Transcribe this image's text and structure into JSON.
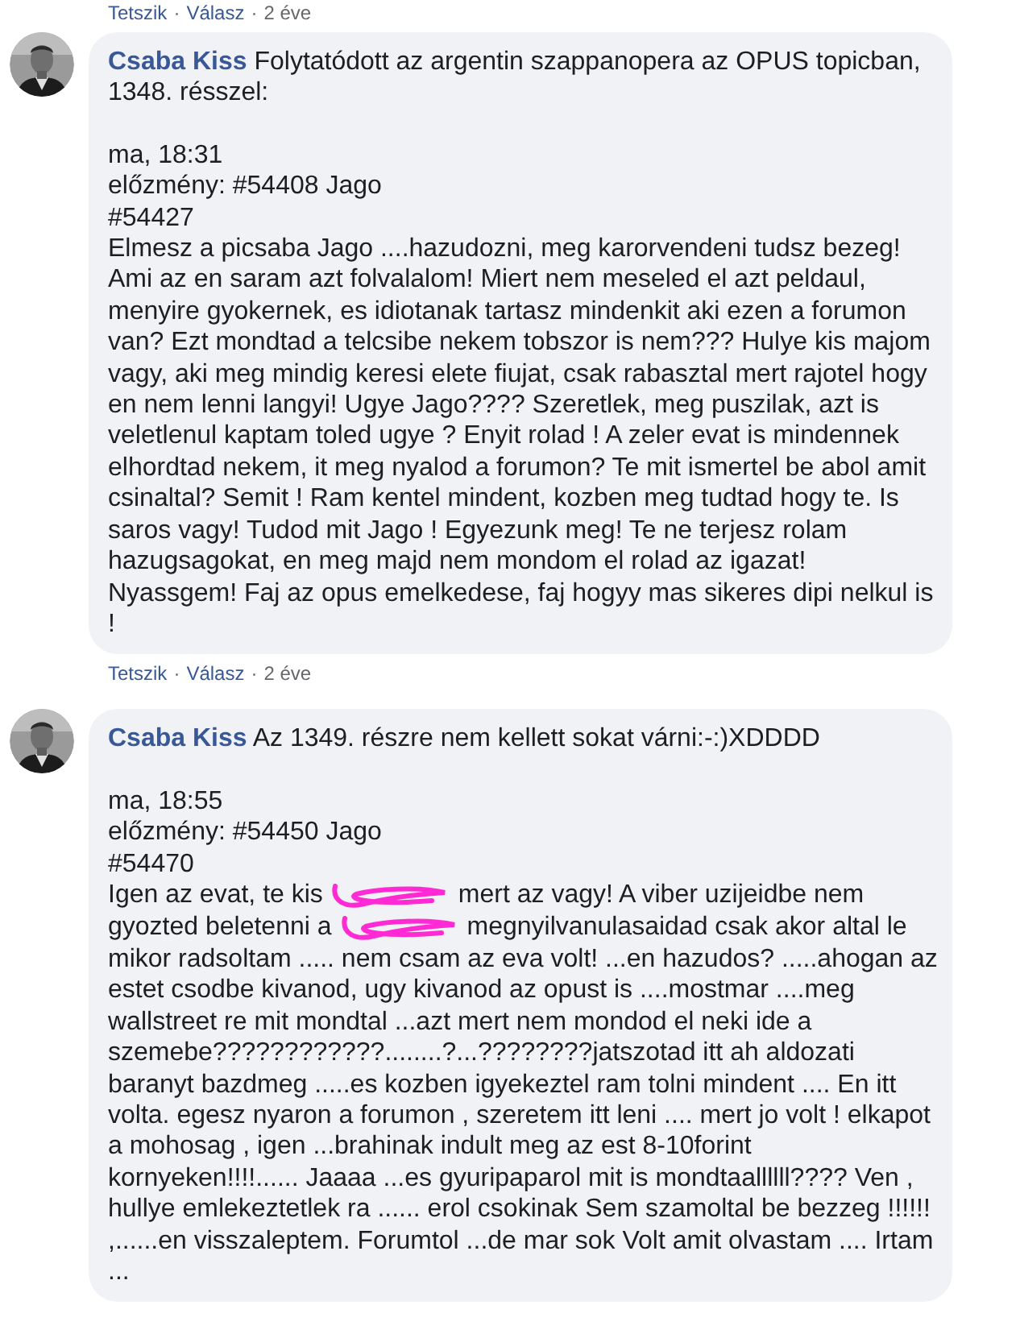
{
  "top_actions": {
    "like": "Tetszik",
    "separator": "·",
    "reply": "Válasz",
    "age": "2 éve"
  },
  "comments": [
    {
      "author": "Csaba Kiss",
      "headline": "Folytatódott az argentin szappanopera az OPUS topicban, 1348. résszel:",
      "time": "ma, 18:31",
      "reply_to": "előzmény: #54408 Jago",
      "post_id": "#54427",
      "body": [
        {
          "kind": "text",
          "text": "Elmesz a picsaba Jago ....hazudozni, meg karorvendeni tudsz bezeg! Ami az en saram azt folvalalom! Miert nem meseled el azt peldaul, menyire gyokernek, es idiotanak tartasz mindenkit aki ezen a forumon van? Ezt mondtad a telcsibe nekem tobszor is nem??? Hulye kis majom vagy, aki meg mindig keresi elete fiujat, csak rabasztal mert rajotel hogy en nem lenni langyi! Ugye Jago???? Szeretlek, meg puszilak, azt is veletlenul kaptam toled ugye ? Enyit rolad ! A zeler evat is mindennek elhordtad nekem, it meg nyalod a forumon? Te mit ismertel be abol amit csinaltal? Semit ! Ram kentel mindent, kozben meg tudtad hogy te. Is saros vagy! Tudod mit Jago ! Egyezunk meg! Te ne terjesz rolam hazugsagokat, en meg majd nem mondom el rolad az igazat! Nyassgem! Faj az opus emelkedese, faj hogyy mas sikeres dipi nelkul is !"
        }
      ],
      "actions": {
        "like": "Tetszik",
        "separator": "·",
        "reply": "Válasz",
        "age": "2 éve"
      }
    },
    {
      "author": "Csaba Kiss",
      "headline": "Az 1349. részre nem kellett sokat várni:-:)XDDDD",
      "time": "ma, 18:55",
      "reply_to": "előzmény: #54450 Jago",
      "post_id": "#54470",
      "body": [
        {
          "kind": "line",
          "parts": [
            {
              "kind": "text",
              "text": "Igen az evat, te kis"
            },
            {
              "kind": "scribble"
            },
            {
              "kind": "text",
              "text": "mert az vagy! A viber uzijeidbe nem"
            }
          ]
        },
        {
          "kind": "line",
          "parts": [
            {
              "kind": "text",
              "text": "gyozted beletenni a"
            },
            {
              "kind": "scribble"
            },
            {
              "kind": "text",
              "text": "megnyilvanulasaidad csak akor altal le"
            }
          ]
        },
        {
          "kind": "text",
          "text": "mikor radsoltam ..... nem csam az eva volt! ...en hazudos? .....ahogan az estet csodbe kivanod, ugy kivanod az opust is ....mostmar ....meg wallstreet re mit mondtal ...azt mert nem mondod el neki ide a szemebe????????????........?...????????jatszotad itt ah aldozati baranyt bazdmeg .....es kozben igyekeztel ram tolni mindent .... En itt volta. egesz nyaron a forumon , szeretem itt leni .... mert jo volt ! elkapot a mohosag , igen ...brahinak indult meg az est 8-10forint kornyeken!!!!...... Jaaaa ...es gyuripaparol mit is mondtaallllll???? Ven , hullye emlekeztetlek ra ...... erol csokinak Sem szamoltal be bezzeg !!!!!! ,......en visszaleptem. Forumtol ...de mar sok Volt amit olvastam .... Irtam ..."
        }
      ]
    }
  ]
}
